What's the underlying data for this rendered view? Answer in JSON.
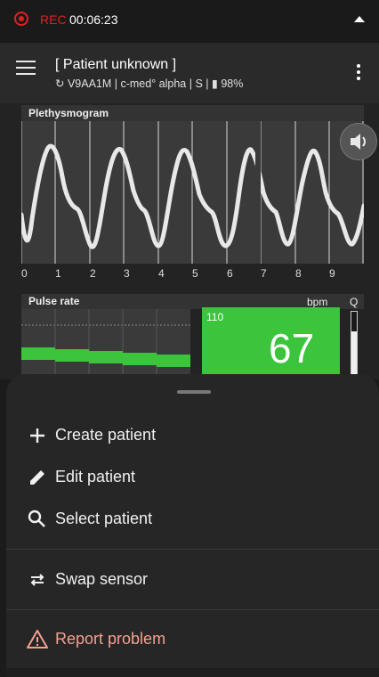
{
  "status_bar": {
    "rec_label": "REC",
    "rec_time": "00:06:23",
    "rec_color": "#e02020"
  },
  "app_bar": {
    "patient_title": "[ Patient unknown ]",
    "subtitle": "↻ V9AA1M | c-med° alpha | S | ▮ 98%"
  },
  "plethysmogram": {
    "label": "Plethysmogram",
    "time_ticks": [
      "0",
      "1",
      "2",
      "3",
      "4",
      "5",
      "6",
      "7",
      "8",
      "9"
    ],
    "waveform_color": "#e8e8e8"
  },
  "pulse_rate": {
    "label": "Pulse rate",
    "unit": "bpm",
    "quality_label": "Q",
    "upper_limit": "110",
    "value": "67",
    "panel_color": "#3cc43c",
    "trend_color": "#3cc43c"
  },
  "sheet_menu": {
    "items": [
      {
        "label": "Create patient",
        "icon": "plus-icon"
      },
      {
        "label": "Edit patient",
        "icon": "pencil-icon"
      },
      {
        "label": "Select patient",
        "icon": "search-icon"
      },
      {
        "label": "Swap sensor",
        "icon": "swap-icon"
      },
      {
        "label": "Report problem",
        "icon": "warning-icon"
      }
    ],
    "report_color": "#f4a090"
  }
}
